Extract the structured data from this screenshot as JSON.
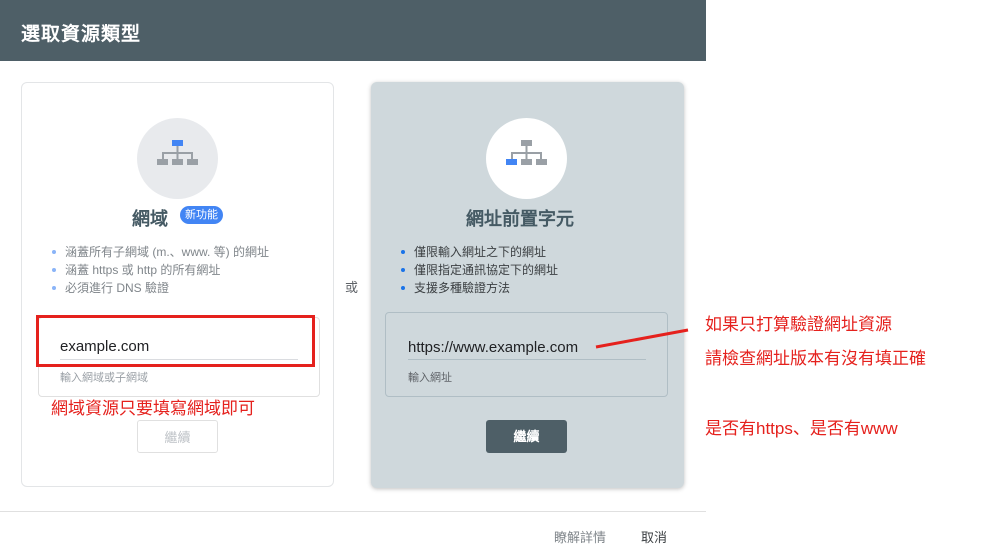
{
  "dialog": {
    "title": "選取資源類型",
    "or_label": "或",
    "footer": {
      "learn_more": "瞭解詳情",
      "cancel": "取消"
    }
  },
  "domain_card": {
    "title": "網域",
    "badge": "新功能",
    "bullets": [
      "涵蓋所有子網域 (m.、www. 等) 的網址",
      "涵蓋 https 或 http 的所有網址",
      "必須進行 DNS 驗證"
    ],
    "input_value": "example.com",
    "input_hint": "輸入網域或子網域",
    "button": "繼續"
  },
  "prefix_card": {
    "title": "網址前置字元",
    "bullets": [
      "僅限輸入網址之下的網址",
      "僅限指定通訊協定下的網址",
      "支援多種驗證方法"
    ],
    "input_value": "https://www.example.com",
    "input_hint": "輸入網址",
    "button": "繼續"
  },
  "annotations": {
    "domain_note": "網域資源只要填寫網域即可",
    "prefix_note_line1": "如果只打算驗證網址資源",
    "prefix_note_line2": "請檢查網址版本有沒有填正確",
    "prefix_note_line3": "是否有https、是否有www"
  },
  "colors": {
    "header_bg": "#4e5f67",
    "selected_card_bg": "#cfd8dc",
    "badge_blue": "#4285f4",
    "annotation_red": "#e5211d"
  }
}
